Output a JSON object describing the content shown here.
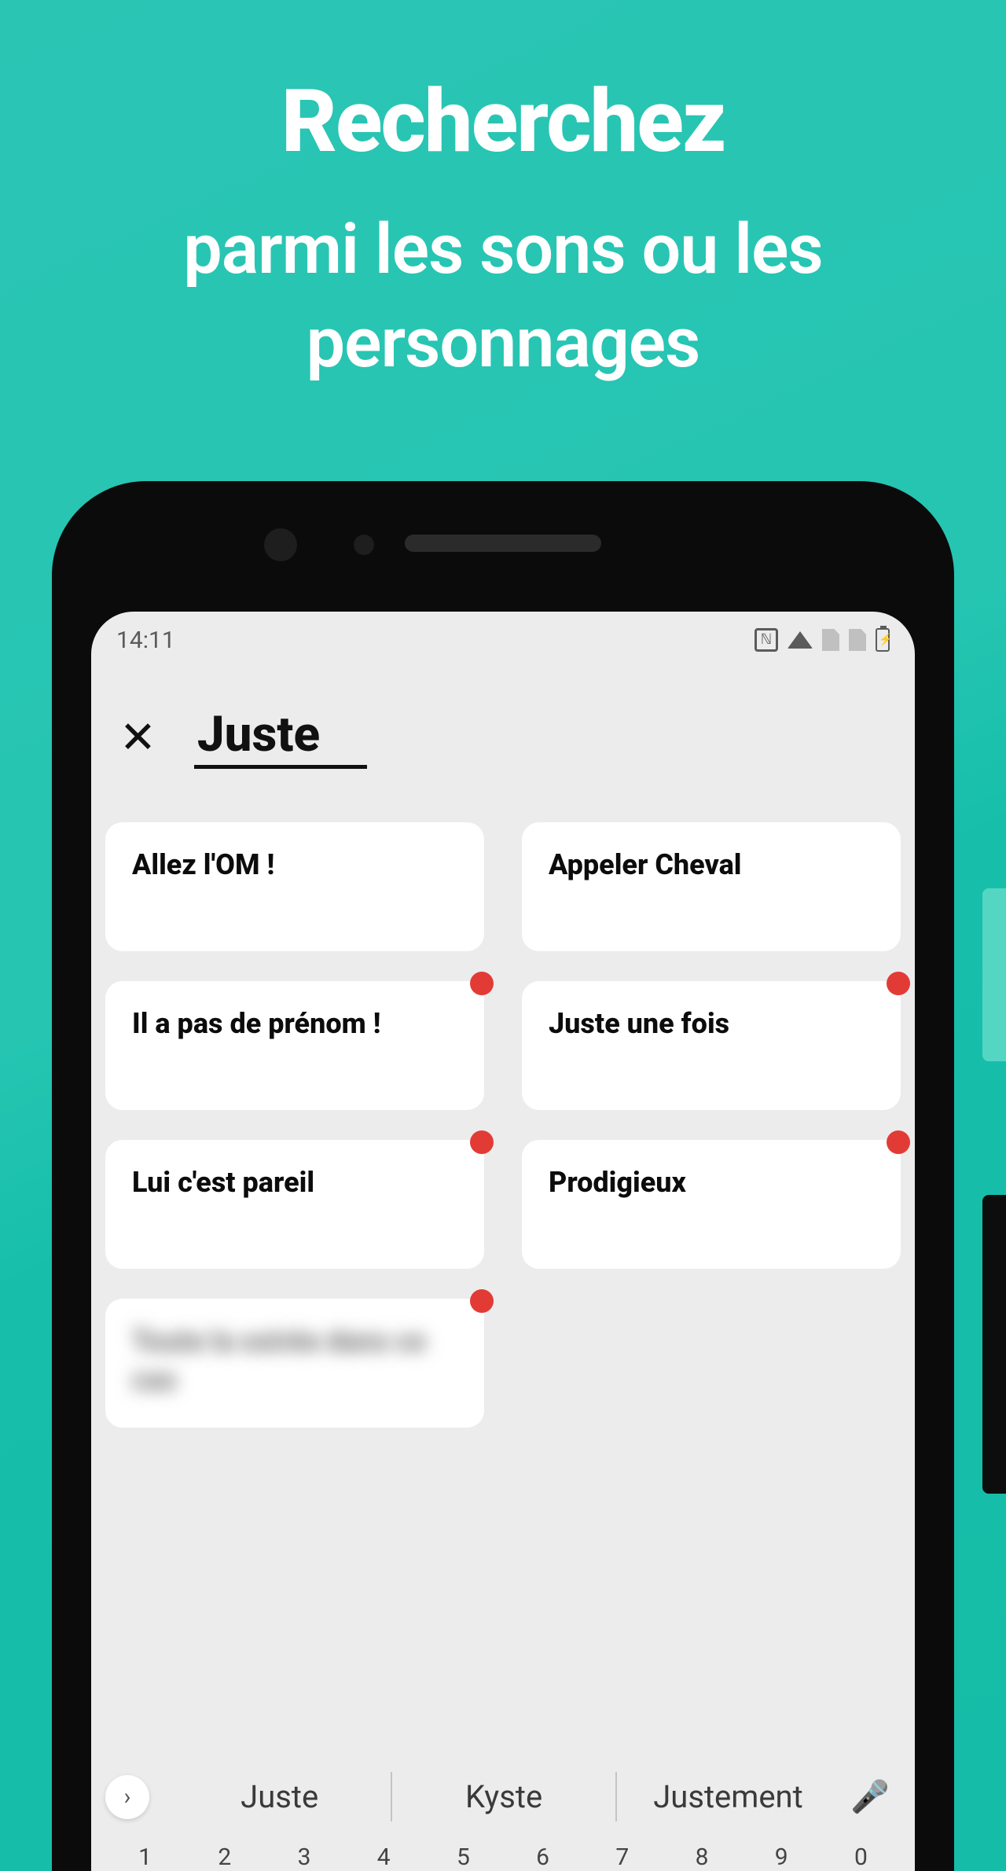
{
  "hero": {
    "title": "Recherchez",
    "subtitle": "parmi les sons ou les personnages"
  },
  "status": {
    "time": "14:11"
  },
  "search": {
    "query": "Juste"
  },
  "cards": [
    {
      "label": "Allez l'OM !",
      "badge": false,
      "blurred": false
    },
    {
      "label": "Appeler Cheval",
      "badge": false,
      "blurred": false
    },
    {
      "label": "Il a pas de prénom !",
      "badge": true,
      "blurred": false
    },
    {
      "label": "Juste une fois",
      "badge": true,
      "blurred": false
    },
    {
      "label": "Lui c'est pareil",
      "badge": true,
      "blurred": false
    },
    {
      "label": "Prodigieux",
      "badge": true,
      "blurred": false
    },
    {
      "label": "Toute la soirée dans ce cas",
      "badge": true,
      "blurred": true
    }
  ],
  "keyboard": {
    "suggestions": [
      "Juste",
      "Kyste",
      "Justement"
    ],
    "numbers": [
      "1",
      "2",
      "3",
      "4",
      "5",
      "6",
      "7",
      "8",
      "9",
      "0"
    ]
  }
}
